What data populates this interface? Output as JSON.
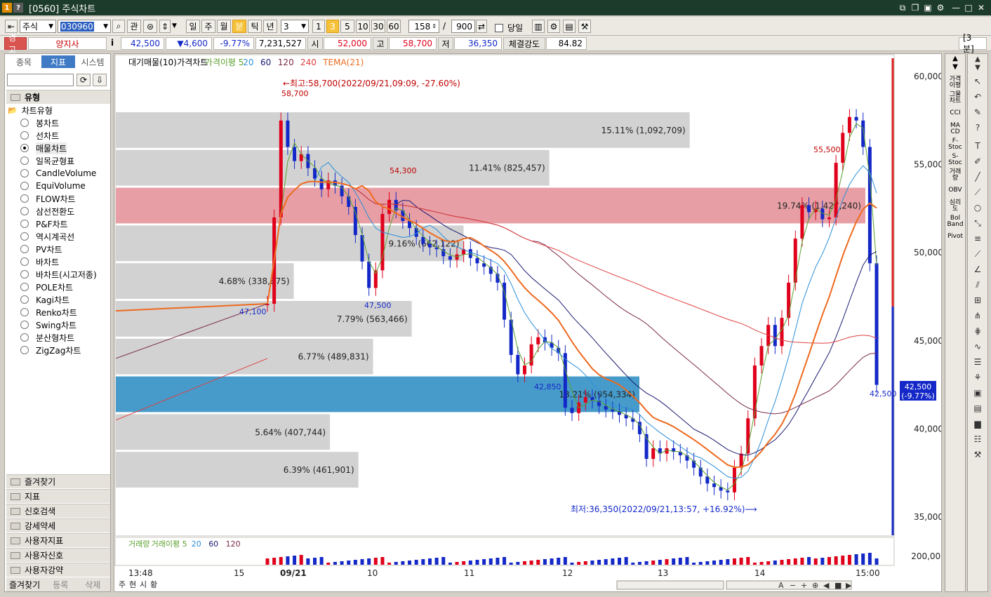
{
  "window": {
    "badge1": "1",
    "badge2": "?",
    "title": "[0560] 주식차트"
  },
  "toolbar": {
    "market": "주식",
    "code": "030960",
    "gwan": "관",
    "periods": [
      "일",
      "주",
      "월",
      "분",
      "틱",
      "년"
    ],
    "active_period": "분",
    "interval_value": "3",
    "quick": [
      "1",
      "3",
      "5",
      "10",
      "30",
      "60"
    ],
    "active_quick": "3",
    "count": "158",
    "slash": "/",
    "total": "900",
    "today_label": "당일"
  },
  "quote": {
    "warn": "경고",
    "name": "양지사",
    "info": "i",
    "price": "42,500",
    "change": "▼4,600",
    "rate": "-9.77%",
    "volume": "7,231,527",
    "open_label": "시",
    "open": "52,000",
    "high_label": "고",
    "high": "58,700",
    "low_label": "저",
    "low": "36,350",
    "strength_label": "체결강도",
    "strength": "84.82",
    "period_tag": "[3분]"
  },
  "sidebar": {
    "tabs": [
      "종목",
      "지표",
      "시스템"
    ],
    "active_tab": "지표",
    "type_header": "유형",
    "group": "차트유형",
    "types": [
      "봉차트",
      "선차트",
      "매물차트",
      "일목균형표",
      "CandleVolume",
      "EquiVolume",
      "FLOW차트",
      "삼선전환도",
      "P&F차트",
      "역시계곡선",
      "PV차트",
      "바차트",
      "바차트(시고저종)",
      "POLE차트",
      "Kagi차트",
      "Renko차트",
      "Swing차트",
      "분산형차트",
      "ZigZag차트"
    ],
    "selected_type": "매물차트",
    "folders": [
      "즐겨찾기",
      "지표",
      "신호검색",
      "강세약세",
      "사용자지표",
      "사용자신호",
      "사용자강약"
    ],
    "bottom": [
      "즐겨찾기",
      "등록",
      "삭제"
    ]
  },
  "legend": {
    "main": [
      "대기매물(10)",
      "가격차트",
      "가격이평 5",
      "20",
      "60",
      "120",
      "240",
      "TEMA(21)"
    ],
    "volume": [
      "거래량",
      "거래이평 5",
      "20",
      "60",
      "120"
    ]
  },
  "colors": {
    "up": "#e0001b",
    "down": "#1428c8",
    "ma5": "#5aa02c",
    "ma20": "#2b8fd8",
    "ma60": "#1a1a70",
    "ma120": "#7a2a4a",
    "ma240": "#e04040",
    "tema": "#ee6a20",
    "sel_band": "#3c96c8",
    "max_band": "#e69aa0"
  },
  "chart_data": {
    "type": "candlestick-volume-profile",
    "y_axis": {
      "min": 35000,
      "max": 60000,
      "ticks": [
        "60,000",
        "55,000",
        "50,000",
        "45,000",
        "40,000",
        "35,000"
      ]
    },
    "x_ticks": [
      "13:48",
      "15",
      "09/21",
      "10",
      "11",
      "12",
      "13",
      "14",
      "15:00"
    ],
    "price_profile": [
      {
        "label": "15.11% (1,092,709)",
        "pct": 15.11,
        "volume": 1092709
      },
      {
        "label": "11.41% (825,457)",
        "pct": 11.41,
        "volume": 825457
      },
      {
        "label": "19.74% (1,427,240)",
        "pct": 19.74,
        "volume": 1427240,
        "highlight": "max"
      },
      {
        "label": "9.16% (662,122)",
        "pct": 9.16,
        "volume": 662122
      },
      {
        "label": "4.68% (338,875)",
        "pct": 4.68,
        "volume": 338875
      },
      {
        "label": "7.79% (563,466)",
        "pct": 7.79,
        "volume": 563466
      },
      {
        "label": "6.77% (489,831)",
        "pct": 6.77,
        "volume": 489831
      },
      {
        "label": "13.21% (954,334)",
        "pct": 13.21,
        "volume": 954334,
        "highlight": "current"
      },
      {
        "label": "5.64% (407,744)",
        "pct": 5.64,
        "volume": 407744
      },
      {
        "label": "6.39% (461,901)",
        "pct": 6.39,
        "volume": 461901
      }
    ],
    "annotations": {
      "high": "←최고:58,700(2022/09/21,09:09, -27.60%)",
      "low": "최저:36,350(2022/09/21,13:57, +16.92%)⟶",
      "labels": [
        "58,700",
        "54,300",
        "47,100",
        "47,500",
        "42,850",
        "55,500",
        "42,500"
      ]
    },
    "current_price": "42,500",
    "current_rate": "(-9.77%)",
    "volume_axis_tick": "200,000",
    "closes": [
      47100,
      52000,
      57500,
      56000,
      55200,
      55600,
      54800,
      54200,
      53600,
      54100,
      53800,
      53200,
      52600,
      51000,
      49500,
      48000,
      49000,
      52200,
      53000,
      52400,
      51800,
      51400,
      50900,
      50500,
      50300,
      50200,
      49800,
      49600,
      49900,
      50200,
      49700,
      49400,
      49200,
      48800,
      48300,
      46200,
      44200,
      43100,
      43600,
      44800,
      45200,
      44900,
      44600,
      44300,
      41200,
      40900,
      41500,
      41800,
      41600,
      41300,
      41100,
      41000,
      40800,
      40600,
      40400,
      39700,
      38300,
      38900,
      38600,
      38900,
      38700,
      38500,
      38200,
      37800,
      37300,
      36900,
      36700,
      36500,
      36400,
      37800,
      38600,
      40600,
      43600,
      44700,
      45900,
      44700,
      46300,
      48300,
      50800,
      52700,
      52300,
      52500,
      51900,
      52000,
      55100,
      56800,
      57700,
      57500,
      56000,
      49400,
      42500
    ]
  },
  "bottom_nav": [
    "주",
    "현",
    "시",
    "황"
  ]
}
